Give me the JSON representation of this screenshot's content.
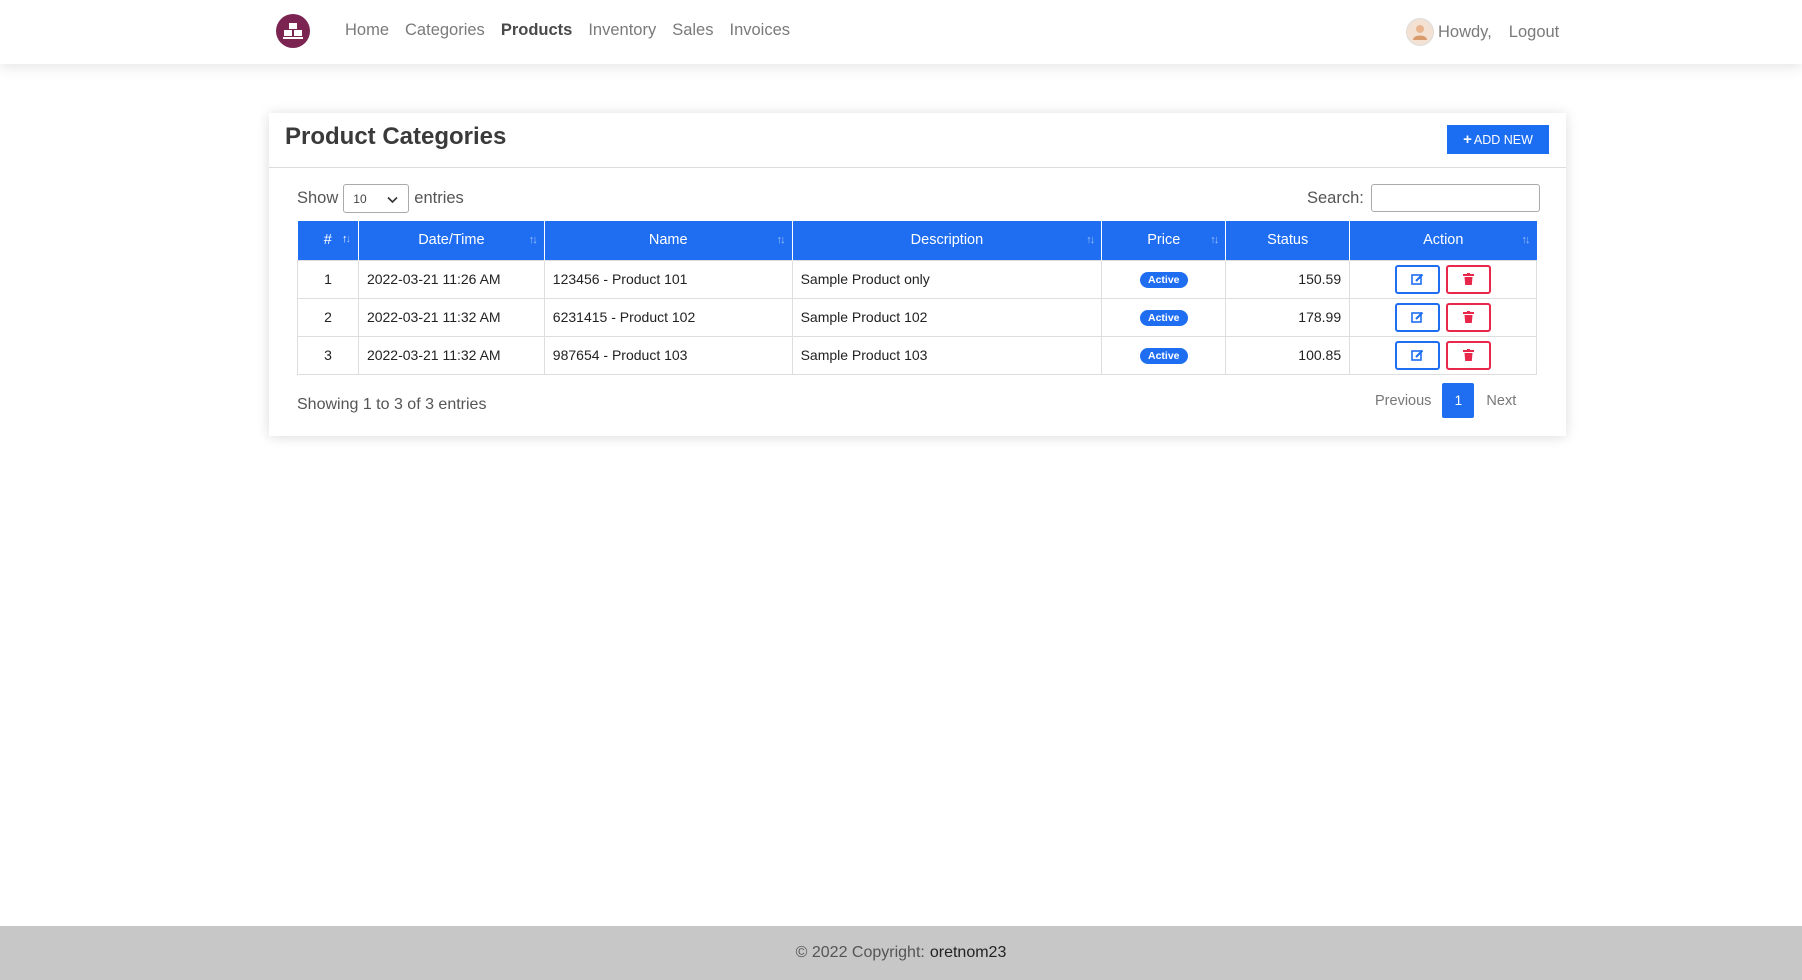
{
  "nav": {
    "items": [
      {
        "label": "Home",
        "active": false
      },
      {
        "label": "Categories",
        "active": false
      },
      {
        "label": "Products",
        "active": true
      },
      {
        "label": "Inventory",
        "active": false
      },
      {
        "label": "Sales",
        "active": false
      },
      {
        "label": "Invoices",
        "active": false
      }
    ],
    "greeting": "Howdy,",
    "logout": "Logout"
  },
  "card": {
    "title": "Product Categories",
    "add_button": "ADD NEW"
  },
  "controls": {
    "show_label": "Show",
    "entries_value": "10",
    "entries_label": "entries",
    "search_label": "Search:",
    "search_value": ""
  },
  "table": {
    "columns": [
      "#",
      "Date/Time",
      "Name",
      "Description",
      "Price",
      "Status",
      "Action"
    ],
    "rows": [
      {
        "num": "1",
        "datetime": "2022-03-21 11:26 AM",
        "name": "123456 - Product 101",
        "description": "Sample Product only",
        "badge": "Active",
        "amount": "150.59"
      },
      {
        "num": "2",
        "datetime": "2022-03-21 11:32 AM",
        "name": "6231415 - Product 102",
        "description": "Sample Product 102",
        "badge": "Active",
        "amount": "178.99"
      },
      {
        "num": "3",
        "datetime": "2022-03-21 11:32 AM",
        "name": "987654 - Product 103",
        "description": "Sample Product 103",
        "badge": "Active",
        "amount": "100.85"
      }
    ]
  },
  "pagination": {
    "info": "Showing 1 to 3 of 3 entries",
    "previous": "Previous",
    "current": "1",
    "next": "Next"
  },
  "footer": {
    "copyright": "© 2022 Copyright:",
    "owner": "oretnom23"
  },
  "colors": {
    "primary": "#1f6ef1",
    "danger": "#e8274b",
    "logo": "#7b2351",
    "footer_bg": "#c7c7c7"
  },
  "icons": {
    "logo": "store-logo-icon",
    "avatar": "user-avatar-icon",
    "add": "plus-icon",
    "edit": "edit-icon",
    "delete": "trash-icon",
    "select": "chevron-down-icon",
    "sort": "sort-icon"
  }
}
